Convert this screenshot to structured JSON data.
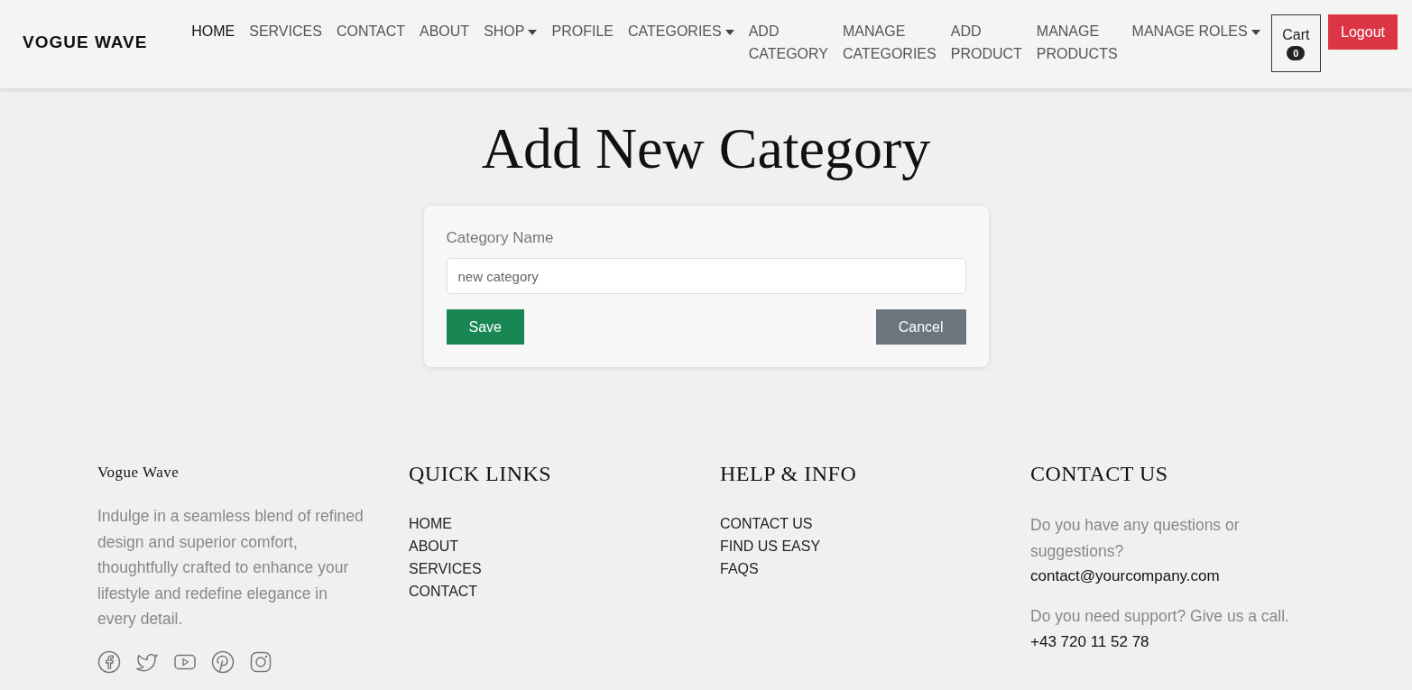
{
  "brand": "VOGUE WAVE",
  "nav": [
    {
      "label": "HOME",
      "selected": true,
      "dropdown": false
    },
    {
      "label": "SERVICES",
      "selected": false,
      "dropdown": false
    },
    {
      "label": "CONTACT",
      "selected": false,
      "dropdown": false
    },
    {
      "label": "ABOUT",
      "selected": false,
      "dropdown": false
    },
    {
      "label": "SHOP",
      "selected": false,
      "dropdown": true
    },
    {
      "label": "PROFILE",
      "selected": false,
      "dropdown": false
    },
    {
      "label": "CATEGORIES",
      "selected": false,
      "dropdown": true
    },
    {
      "label": "ADD CATEGORY",
      "selected": false,
      "dropdown": false
    },
    {
      "label": "MANAGE CATEGORIES",
      "selected": false,
      "dropdown": false
    },
    {
      "label": "ADD PRODUCT",
      "selected": false,
      "dropdown": false
    },
    {
      "label": "MANAGE PRODUCTS",
      "selected": false,
      "dropdown": false
    },
    {
      "label": "MANAGE ROLES",
      "selected": false,
      "dropdown": true
    }
  ],
  "cart": {
    "label": "Cart",
    "count": "0"
  },
  "logout": "Logout",
  "heading": "Add New Category",
  "form": {
    "label": "Category Name",
    "placeholder": "new category",
    "save": "Save",
    "cancel": "Cancel"
  },
  "footer": {
    "about": {
      "title": "Vogue Wave",
      "text": "Indulge in a seamless blend of refined design and superior comfort, thoughtfully crafted to enhance your lifestyle and redefine elegance in every detail.",
      "socials": [
        {
          "kind": "facebook"
        },
        {
          "kind": "twitter"
        },
        {
          "kind": "youtube"
        },
        {
          "kind": "pinterest"
        },
        {
          "kind": "instagram"
        }
      ]
    },
    "quick_links": {
      "title": "QUICK LINKS",
      "links": [
        "HOME",
        "ABOUT",
        "SERVICES",
        "CONTACT"
      ]
    },
    "help": {
      "title": "HELP & INFO",
      "links": [
        "CONTACT US",
        "FIND US EASY",
        "FAQS"
      ]
    },
    "contact": {
      "title": "CONTACT US",
      "question": "Do you have any questions or suggestions?",
      "email": "contact@yourcompany.com",
      "support": "Do you need support? Give us a call.",
      "phone": "+43 720 11 52 78"
    }
  }
}
